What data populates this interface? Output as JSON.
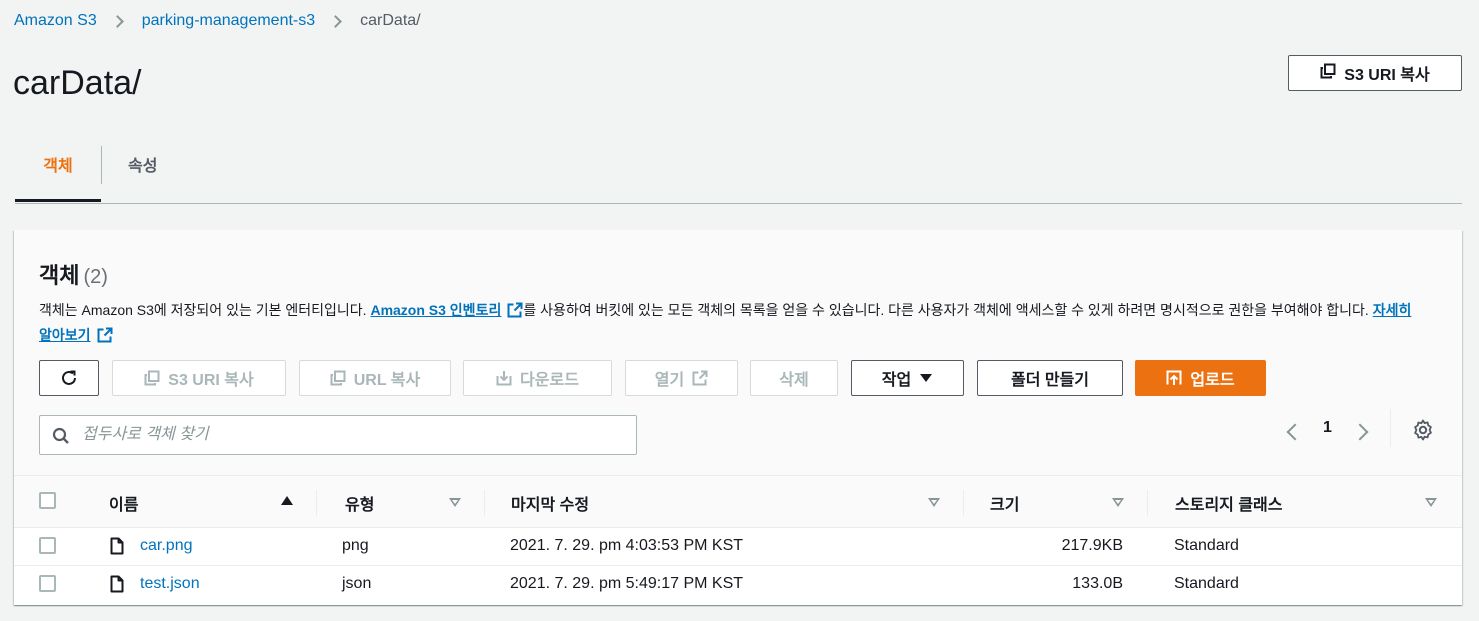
{
  "breadcrumb": {
    "root": "Amazon S3",
    "bucket": "parking-management-s3",
    "current": "carData/"
  },
  "page": {
    "title": "carData/",
    "copy_uri_label": "S3 URI 복사"
  },
  "tabs": [
    {
      "label": "객체",
      "active": true
    },
    {
      "label": "속성",
      "active": false
    }
  ],
  "objects": {
    "title": "객체",
    "count": "(2)",
    "desc_part1": "객체는 Amazon S3에 저장되어 있는 기본 엔터티입니다. ",
    "desc_link1": "Amazon S3 인벤토리",
    "desc_part2": "를 사용하여 버킷에 있는 모든 객체의 목록을 얻을 수 있습니다. 다른 사용자가 객체에 액세스할 수 있게 하려면 명시적으로 권한을 부여해야 합니다. ",
    "desc_link2": "자세히 알아보기"
  },
  "toolbar": {
    "copy_s3_uri": "S3 URI 복사",
    "copy_url": "URL 복사",
    "download": "다운로드",
    "open": "열기",
    "delete": "삭제",
    "actions": "작업",
    "create_folder": "폴더 만들기",
    "upload": "업로드"
  },
  "search": {
    "placeholder": "접두사로 객체 찾기",
    "value": ""
  },
  "pagination": {
    "current_page": "1"
  },
  "table": {
    "headers": {
      "name": "이름",
      "type": "유형",
      "modified": "마지막 수정",
      "size": "크기",
      "storage_class": "스토리지 클래스"
    },
    "rows": [
      {
        "name": "car.png",
        "type": "png",
        "modified": "2021. 7. 29. pm 4:03:53 PM KST",
        "size": "217.9KB",
        "storage_class": "Standard"
      },
      {
        "name": "test.json",
        "type": "json",
        "modified": "2021. 7. 29. pm 5:49:17 PM KST",
        "size": "133.0B",
        "storage_class": "Standard"
      }
    ]
  },
  "colors": {
    "link": "#0073bb",
    "accent": "#ec7211",
    "text": "#16191f"
  }
}
